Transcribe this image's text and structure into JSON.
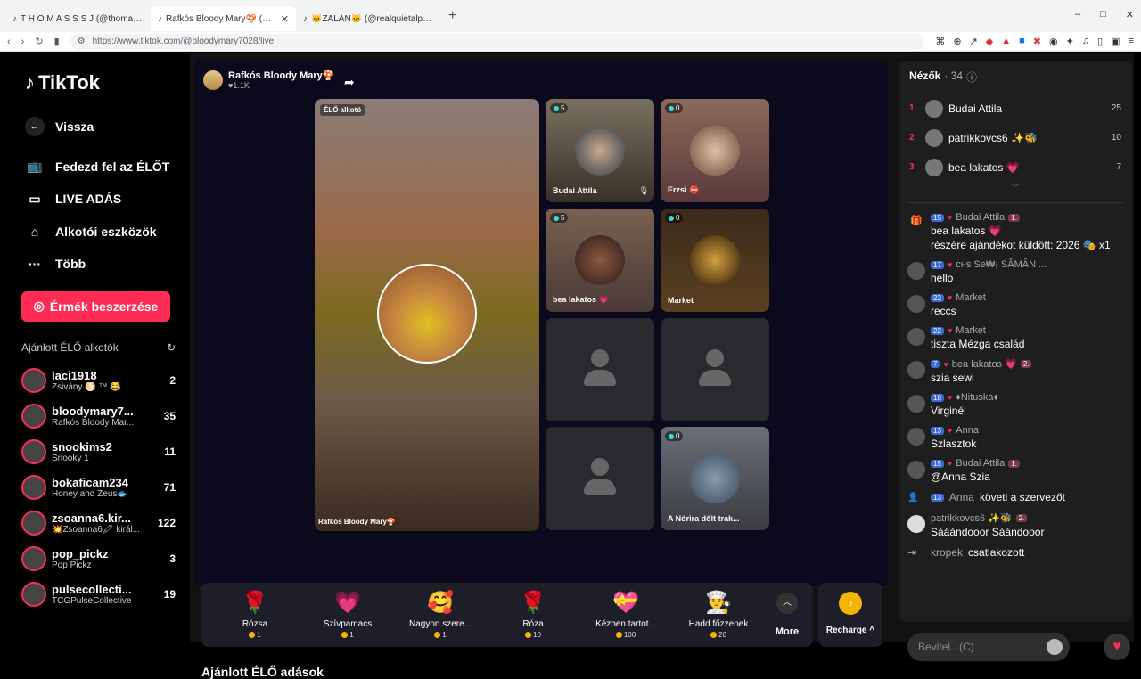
{
  "browser": {
    "tabs": [
      {
        "title": "T H O M A S S S J (@thomass...",
        "active": false
      },
      {
        "title": "Rafkós Bloody Mary🍄 (@blo...",
        "active": true
      },
      {
        "title": "🐱ZALÁN🐱 (@realquietalpha) ÉLŐ",
        "active": false
      }
    ],
    "url": "https://www.tiktok.com/@bloodymary7028/live",
    "window_controls": [
      "–",
      "□",
      "✕"
    ]
  },
  "sidebar": {
    "logo": "TikTok",
    "back": "Vissza",
    "nav": [
      {
        "label": "Fedezd fel az ÉLŐT",
        "icon": "live-tv-icon"
      },
      {
        "label": "LIVE ADÁS",
        "icon": "camera-icon"
      },
      {
        "label": "Alkotói eszközök",
        "icon": "creator-tools-icon"
      },
      {
        "label": "Több",
        "icon": "more-icon"
      }
    ],
    "coins_button": "Érmék beszerzése",
    "recommended_title": "Ajánlott ÉLŐ alkotók",
    "recommended": [
      {
        "name": "laci1918",
        "sub": "Zsivány 🌕 ™ 😂",
        "count": "2"
      },
      {
        "name": "bloodymary7...",
        "sub": "Rafkós Bloody Mar...",
        "count": "35"
      },
      {
        "name": "snookims2",
        "sub": "Snooky 1",
        "count": "11"
      },
      {
        "name": "bokaficam234",
        "sub": "Honey and Zeus🐟",
        "count": "71"
      },
      {
        "name": "zsoanna6.kir...",
        "sub": "💥Zsoanna6🖍 királ...",
        "count": "122"
      },
      {
        "name": "pop_pickz",
        "sub": "Pop Pickz",
        "count": "3"
      },
      {
        "name": "pulsecollecti...",
        "sub": "TCGPulseCollective",
        "count": "19"
      }
    ]
  },
  "stream": {
    "host_name": "Rafkós Bloody Mary🍄",
    "host_likes": "♥1.1K",
    "main_label": "ÉLŐ alkotó",
    "main_name": "Rafkós Bloody Mary🍄",
    "guests": [
      {
        "name": "Budai Attila",
        "count": "5",
        "muted": true
      },
      {
        "name": "Erzsi ⛔",
        "count": "0"
      },
      {
        "name": "bea lakatos 💗",
        "count": "5"
      },
      {
        "name": "Market",
        "count": "0"
      },
      {
        "name": "",
        "count": ""
      },
      {
        "name": "",
        "count": ""
      },
      {
        "name": "",
        "count": ""
      },
      {
        "name": "A Nórira dőlt trak...",
        "count": "0"
      }
    ]
  },
  "gifts": [
    {
      "name": "Rózsa",
      "price": "1",
      "icon": "🌹"
    },
    {
      "name": "Szívpamacs",
      "price": "1",
      "icon": "💗"
    },
    {
      "name": "Nagyon szere...",
      "price": "1",
      "icon": "🥰"
    },
    {
      "name": "Róza",
      "price": "10",
      "icon": "🌹"
    },
    {
      "name": "Kézben tartot...",
      "price": "100",
      "icon": "💝"
    },
    {
      "name": "Hadd főzzenek",
      "price": "20",
      "icon": "👨‍🍳"
    }
  ],
  "gift_more": "More",
  "recharge": "Recharge ^",
  "bottom_title": "Ajánlott ÉLŐ adások",
  "chat": {
    "viewers_label": "Nézők",
    "viewers_count": "· 34",
    "top": [
      {
        "rank": "1",
        "name": "Budai Attila",
        "value": "25"
      },
      {
        "rank": "2",
        "name": "patrikkovcs6 ✨🐝",
        "value": "10"
      },
      {
        "rank": "3",
        "name": "bea lakatos 💗",
        "value": "7"
      }
    ],
    "messages": [
      {
        "level": "15",
        "user": "Budai Attila",
        "fan": "1.",
        "text": "bea lakatos 💗",
        "text2": "részére ajándékot küldött: 2026 🎭 x1",
        "type": "gift"
      },
      {
        "level": "17",
        "user": "ᴄʜѕ Se₩¡ SÂMȂN ...",
        "text": "hello"
      },
      {
        "level": "22",
        "user": "Market",
        "text": "reccs"
      },
      {
        "level": "22",
        "user": "Market",
        "text": "tiszta Mézga család"
      },
      {
        "level": "7",
        "user": "bea lakatos 💗",
        "fan": "2.",
        "text": "szia sewi"
      },
      {
        "level": "18",
        "user": "♦Nituska♦",
        "text": "Virginél"
      },
      {
        "level": "13",
        "user": "Anna",
        "text": "Szlasztok"
      },
      {
        "level": "15",
        "user": "Budai Attila",
        "fan": "1.",
        "text": "@Anna Szia"
      }
    ],
    "follow": {
      "level": "13",
      "user": "Anna",
      "text": "követi a szervezőt"
    },
    "msg_patrik": {
      "user": "patrikkovcs6 ✨🐝",
      "fan": "2.",
      "text": "Sááándooor Sáándooor"
    },
    "join": {
      "user": "kropek",
      "text": "csatlakozott"
    },
    "input_placeholder": "Bevitel...(C)"
  }
}
